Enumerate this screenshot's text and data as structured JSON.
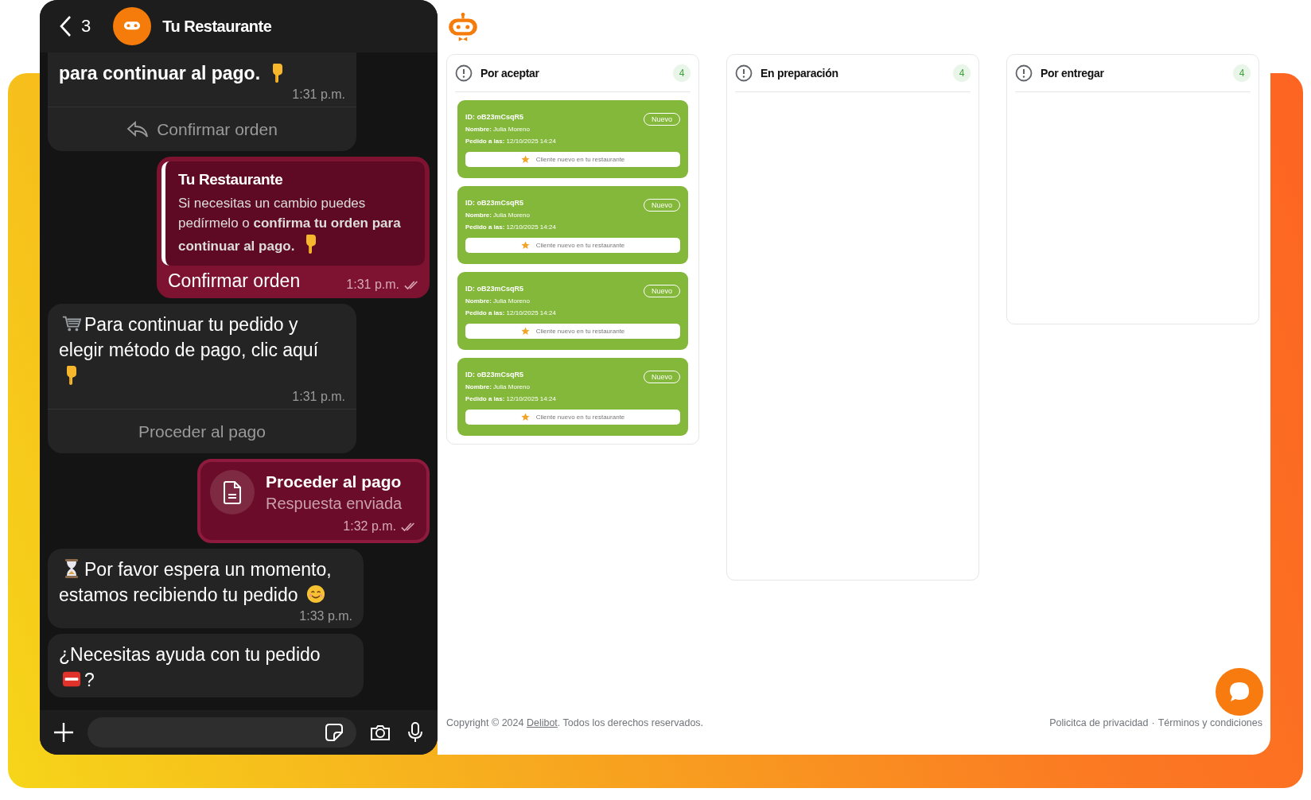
{
  "chat": {
    "header": {
      "back_count": "3",
      "contact": "Tu Restaurante"
    },
    "messages": [
      {
        "kind": "incoming",
        "text": "para continuar al pago.",
        "bold": true,
        "time": "1:31 p.m.",
        "action": "Confirmar orden"
      },
      {
        "kind": "quote_reply",
        "quote_title": "Tu Restaurante",
        "quote_text": "Si necesitas un cambio puedes pedírmelo o **confirma tu orden para continuar al pago.**",
        "text": "Confirmar orden",
        "time": "1:31 p.m.",
        "read": true
      },
      {
        "kind": "incoming",
        "text": "Para continuar tu pedido y elegir método de pago, clic aquí",
        "bold": false,
        "time": "1:31 p.m.",
        "action": "Proceder al pago"
      },
      {
        "kind": "response_sent",
        "title": "Proceder al pago",
        "subtitle": "Respuesta enviada",
        "time": "1:32 p.m.",
        "read": true
      },
      {
        "kind": "incoming",
        "text": "Por favor espera un momento, estamos recibiendo tu pedido",
        "bold": false,
        "time": "1:33 p.m."
      },
      {
        "kind": "incoming",
        "text": "¿Necesitas ayuda con tu pedido",
        "bold": false,
        "tail": "?"
      }
    ]
  },
  "board": {
    "columns": [
      {
        "title": "Por aceptar",
        "count": "4",
        "orders": [
          {
            "id": "ID: oB23mCsqR5",
            "name": "**Nombre:** Julia Moreno",
            "ordered_at": "**Pedido a las:** 12/10/2025 14:24",
            "badge": "Nuevo",
            "note": "Cliente nuevo en tu restaurante"
          },
          {
            "id": "ID: oB23mCsqR5",
            "name": "**Nombre:** Julia Moreno",
            "ordered_at": "**Pedido a las:** 12/10/2025 14:24",
            "badge": "Nuevo",
            "note": "Cliente nuevo en tu restaurante"
          },
          {
            "id": "ID: oB23mCsqR5",
            "name": "**Nombre:** Julia Moreno",
            "ordered_at": "**Pedido a las:** 12/10/2025 14:24",
            "badge": "Nuevo",
            "note": "Cliente nuevo en tu restaurante"
          },
          {
            "id": "ID: oB23mCsqR5",
            "name": "**Nombre:** Julia Moreno",
            "ordered_at": "**Pedido a las:** 12/10/2025 14:24",
            "badge": "Nuevo",
            "note": "Cliente nuevo en tu restaurante"
          }
        ]
      },
      {
        "title": "En preparación",
        "count": "4"
      },
      {
        "title": "Por entregar",
        "count": "4"
      }
    ]
  },
  "footer": {
    "copyright_before": "Copyright © 2024 ",
    "brand_link": "Delibot",
    "copyright_after": ". Todos los derechos reservados.",
    "links": [
      "Policitca de privacidad",
      "Términos y condiciones"
    ],
    "separator": "·"
  }
}
